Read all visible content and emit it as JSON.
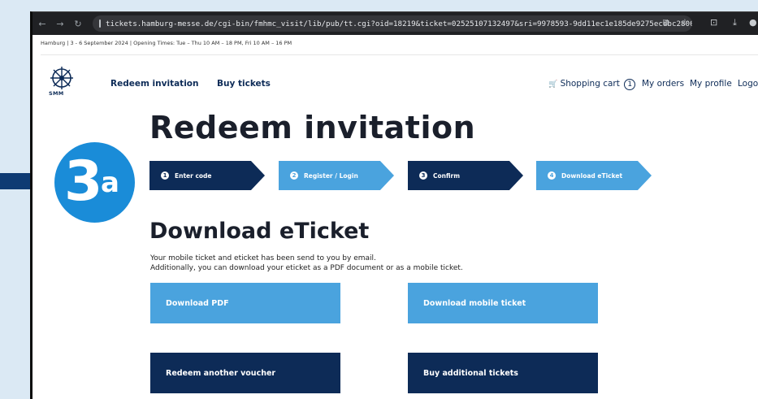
{
  "browser": {
    "url": "tickets.hamburg-messe.de/cgi-bin/fmhmc_visit/lib/pub/tt.cgi?oid=18219&ticket=02525107132497&sri=9978593-9dd11ec1e185de9275ecdbc2800dbdb5&voucher_c...",
    "back_glyph": "←",
    "forward_glyph": "→",
    "reload_glyph": "↻",
    "translate_glyph": "⧉",
    "star_glyph": "☆",
    "extensions_glyph": "⊡",
    "download_glyph": "⤓",
    "profile_glyph": "●"
  },
  "info_bar": "Hamburg | 3 - 6 September 2024 | Opening Times: Tue – Thu 10 AM – 18 PM, Fri 10 AM – 16 PM",
  "logo": {
    "text": "SMM"
  },
  "nav": {
    "redeem": "Redeem invitation",
    "buy": "Buy tickets",
    "cart_glyph": "🛒",
    "cart": "Shopping cart",
    "cart_count": "1",
    "orders": "My orders",
    "profile": "My profile",
    "logout": "Logou"
  },
  "page_title": "Redeem invitation",
  "badge": {
    "number": "3",
    "letter": "a"
  },
  "steps": [
    {
      "num": "1",
      "label": "Enter code"
    },
    {
      "num": "2",
      "label": "Register / Login"
    },
    {
      "num": "3",
      "label": "Confirm"
    },
    {
      "num": "4",
      "label": "Download eTicket"
    }
  ],
  "section_title": "Download eTicket",
  "description": {
    "line1": "Your mobile ticket and eticket has been send to you by email.",
    "line2": "Additionally, you can download your eticket as a PDF document or as a mobile ticket."
  },
  "buttons": {
    "download_pdf": "Download PDF",
    "download_mobile": "Download mobile ticket",
    "redeem_another": "Redeem another voucher",
    "buy_additional": "Buy additional tickets"
  },
  "colors": {
    "navy": "#0d2b57",
    "light_blue": "#4aa3de",
    "badge_blue": "#1a8cd8"
  }
}
